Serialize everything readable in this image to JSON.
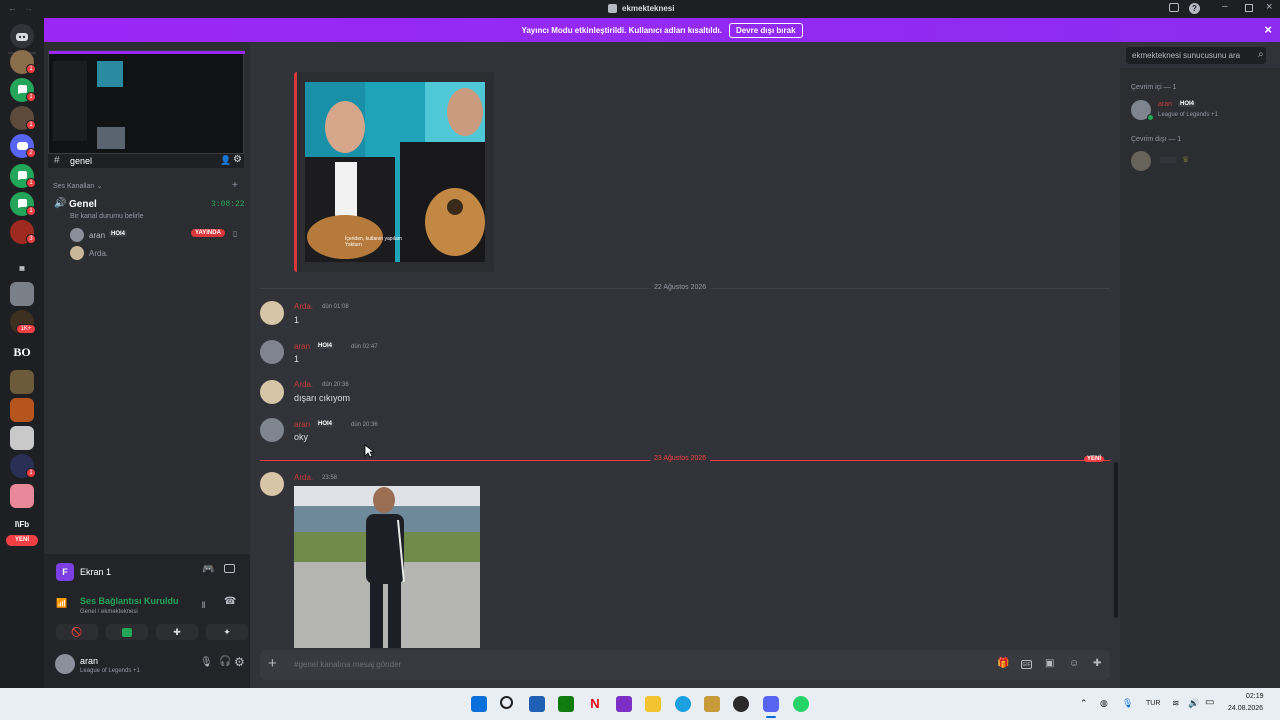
{
  "window": {
    "title": "ekmekteknesi"
  },
  "banner": {
    "text": "Yayıncı Modu etkinleştirildi. Kullanıcı adları kısaltıldı.",
    "button": "Devre dışı bırak"
  },
  "guild_badges": [
    "1",
    "1",
    "1",
    "1",
    "2",
    "1",
    "1",
    "3",
    "1",
    "1K+",
    "1",
    "1"
  ],
  "guild_labels": {
    "bo": "BO",
    "fb": "I\\Fb",
    "new": "YENİ"
  },
  "sidebar": {
    "channel_header": "genel",
    "voice_section": "Ses Kanalları",
    "voice_channel": {
      "name": "Genel",
      "timer": "3:08:22",
      "status": "Bir kanal durumu belirle"
    },
    "voice_users": [
      {
        "name": "aran",
        "tag": "HOI4",
        "badge": "YAYINDA"
      },
      {
        "name": "Arda."
      }
    ],
    "screen_share": "Ekran 1",
    "voice_connected": "Ses Bağlantısı Kuruldu",
    "voice_location": "Genel / ekmekteknesi",
    "user": {
      "name": "aran",
      "activity": "League of Legends +1"
    }
  },
  "topbar": {
    "channel": "genel",
    "search_placeholder": "ekmekteknesi sunucusunu ara"
  },
  "chat": {
    "date_separator_1": "22 Ağustos 2026",
    "date_separator_2": "23 Ağustos 2026",
    "new_label": "YENİ",
    "image_caption": "İçeriden, kutlanın yapılam Yakturn",
    "messages": [
      {
        "author": "Arda.",
        "time": "dün 01:08",
        "text": "1"
      },
      {
        "author": "aran",
        "tag": "HOI4",
        "time": "dün 02:47",
        "text": "1"
      },
      {
        "author": "Arda.",
        "time": "dün 20:36",
        "text": "dışarı cıkıyom"
      },
      {
        "author": "aran",
        "tag": "HOI4",
        "time": "dün 20:36",
        "text": "oky"
      },
      {
        "author": "Arda.",
        "time": "23:58",
        "text": ""
      }
    ],
    "input_placeholder": "#genel kanalına mesaj gönder"
  },
  "members": {
    "online_header": "Çevrim içi — 1",
    "online": [
      {
        "name": "aran",
        "tag": "HOI4",
        "activity": "League of Legends +1"
      }
    ],
    "offline_header": "Çevrim dışı — 1"
  },
  "tray": {
    "lang": "TUR",
    "time": "02:19",
    "date": "24.08.2026"
  },
  "colors": {
    "accent": "#5865f2",
    "banner": "#9b27f5",
    "live": "#da373c",
    "green": "#23a55a",
    "mention": "#f23f43"
  }
}
